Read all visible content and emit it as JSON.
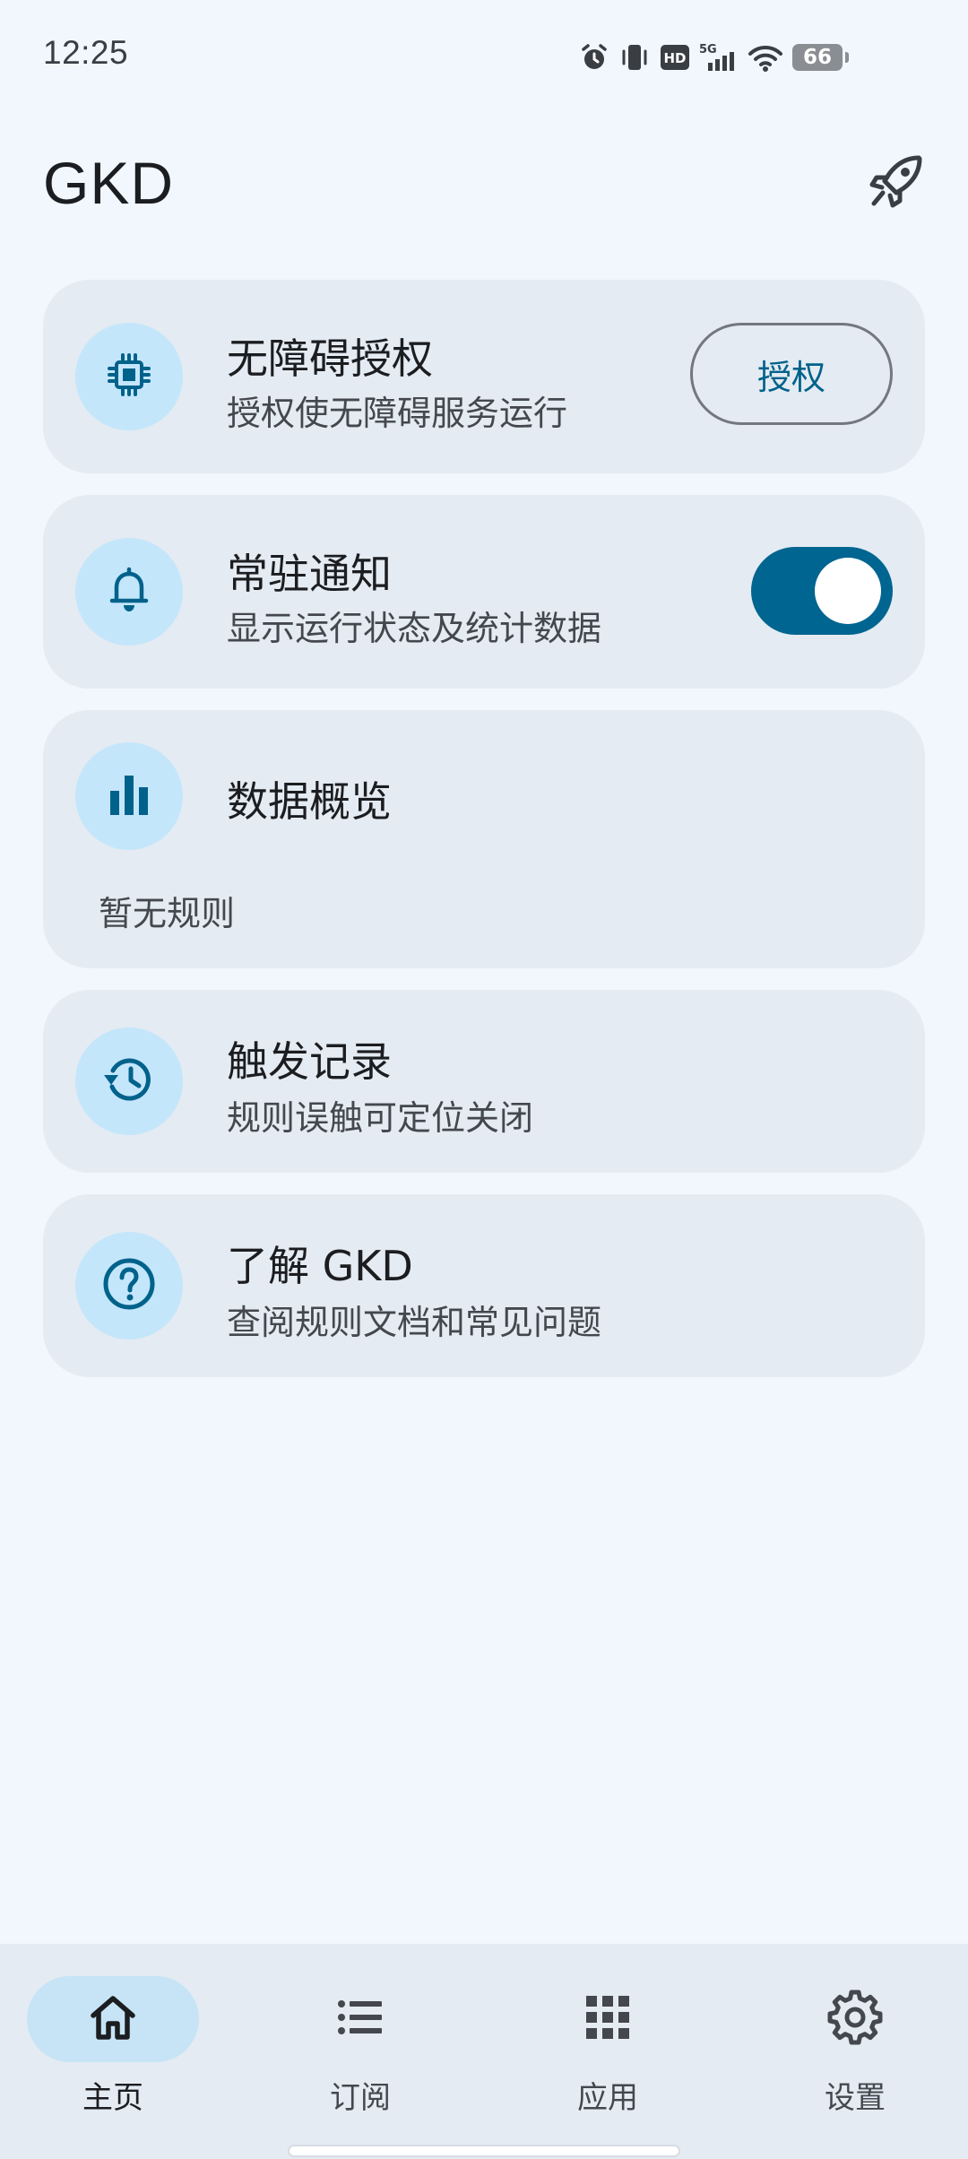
{
  "status_bar": {
    "time": "12:25",
    "icons": [
      "alarm-icon",
      "vibrate-icon",
      "hd-icon",
      "signal-5g-icon",
      "wifi-icon",
      "battery-icon"
    ],
    "hd_label": "HD",
    "network_label": "5G",
    "battery_level": "66"
  },
  "header": {
    "title": "GKD",
    "action_icon": "rocket-icon"
  },
  "cards": {
    "accessibility": {
      "icon": "chip-icon",
      "title": "无障碍授权",
      "subtitle": "授权使无障碍服务运行",
      "button_label": "授权"
    },
    "notification": {
      "icon": "bell-icon",
      "title": "常驻通知",
      "subtitle": "显示运行状态及统计数据",
      "toggle_on": true
    },
    "overview": {
      "icon": "bar-chart-icon",
      "title": "数据概览",
      "empty_text": "暂无规则"
    },
    "history": {
      "icon": "history-icon",
      "title": "触发记录",
      "subtitle": "规则误触可定位关闭"
    },
    "about": {
      "icon": "help-circle-icon",
      "title": "了解 GKD",
      "subtitle": "查阅规则文档和常见问题"
    }
  },
  "bottom_nav": {
    "items": [
      {
        "label": "主页",
        "icon": "home-icon",
        "active": true
      },
      {
        "label": "订阅",
        "icon": "list-icon",
        "active": false
      },
      {
        "label": "应用",
        "icon": "apps-grid-icon",
        "active": false
      },
      {
        "label": "设置",
        "icon": "settings-icon",
        "active": false
      }
    ]
  },
  "colors": {
    "background": "#f1f7fd",
    "card": "#e4ebf2",
    "accent": "#00628b",
    "icon_circle": "#c4e6fb",
    "toggle_track": "#006590"
  }
}
